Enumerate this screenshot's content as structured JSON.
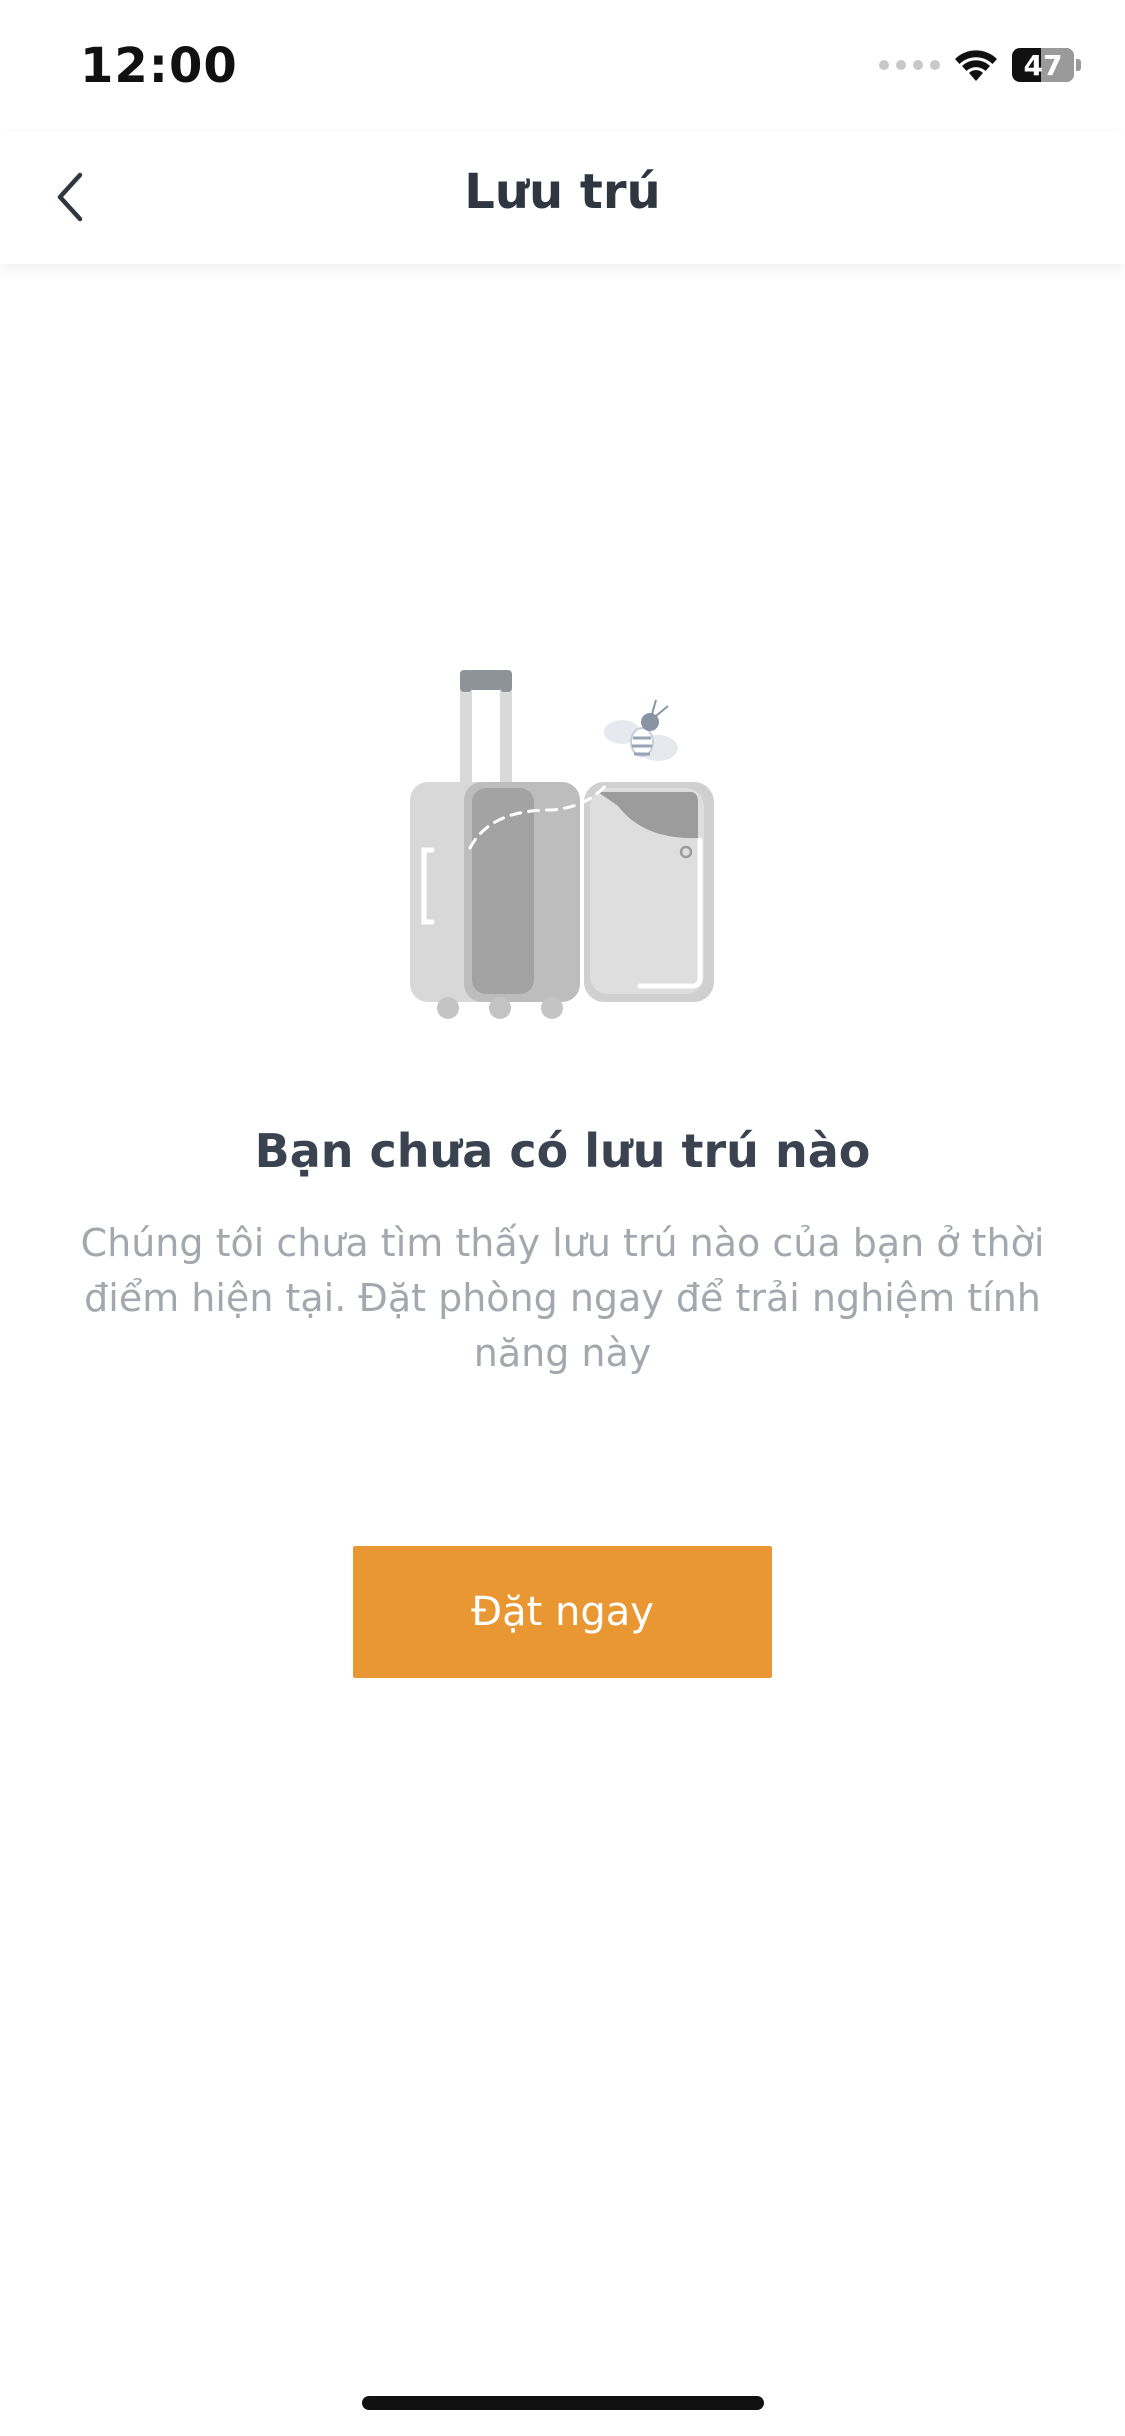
{
  "status_bar": {
    "time": "12:00",
    "battery": "47",
    "icons": [
      "cellular-signal-icon",
      "wifi-icon",
      "battery-icon"
    ]
  },
  "header": {
    "title": "Lưu trú",
    "back_icon": "chevron-left-icon"
  },
  "empty_state": {
    "illustration": "open-suitcase-with-bee-illustration",
    "title": "Bạn chưa có lưu trú nào",
    "description": "Chúng tôi chưa tìm thấy lưu trú nào của bạn ở thời điểm hiện tại. Đặt phòng ngay để trải nghiệm tính năng này",
    "button_label": "Đặt ngay"
  },
  "colors": {
    "accent": "#e89732",
    "title_text": "#3b4350",
    "muted_text": "#a4a8ae"
  }
}
